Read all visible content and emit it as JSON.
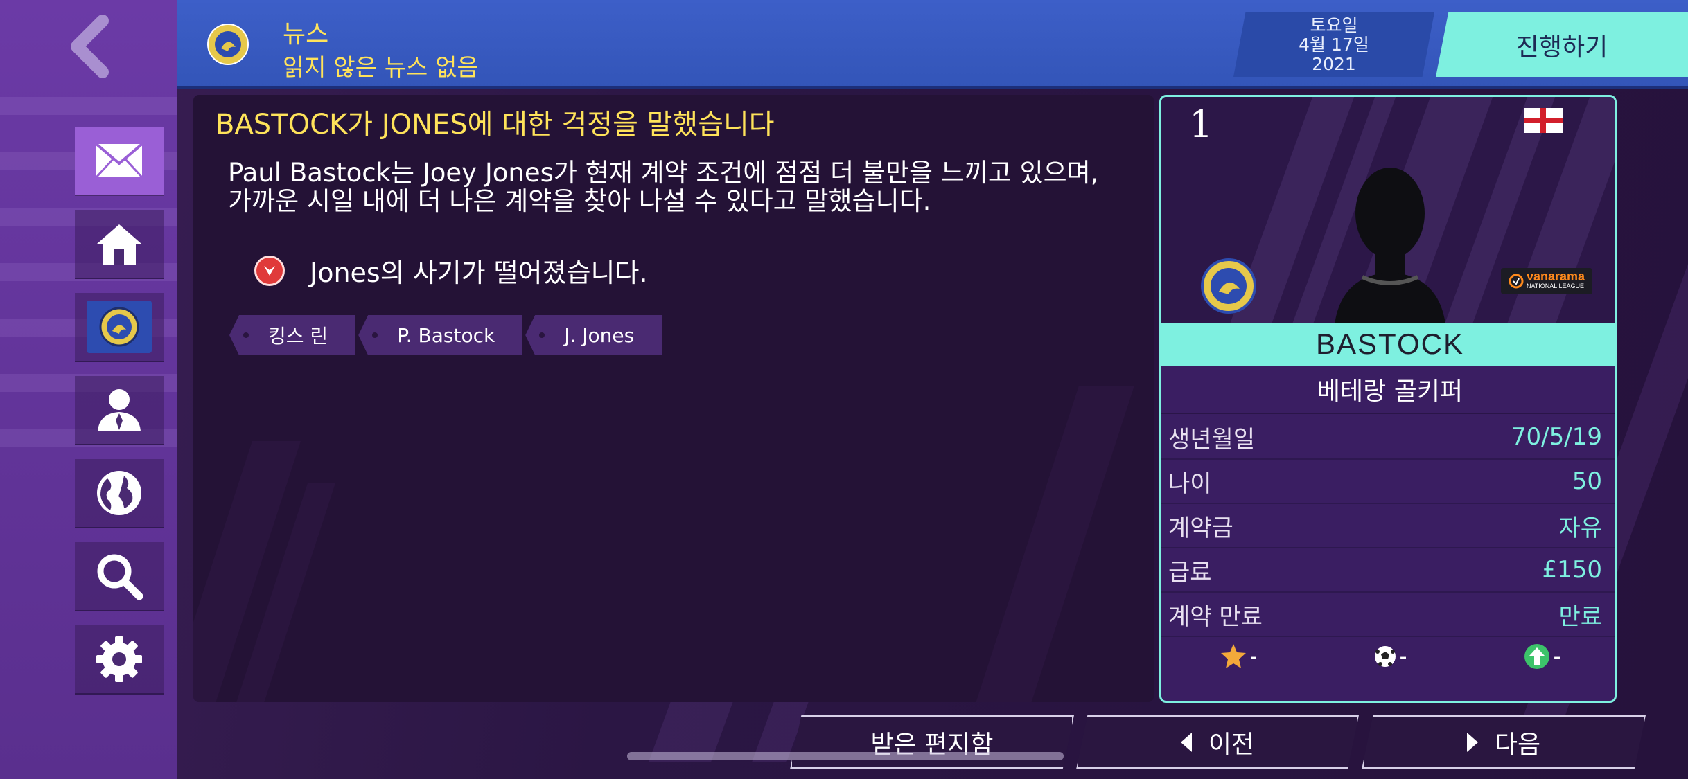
{
  "header": {
    "section_title": "뉴스",
    "subtitle": "읽지 않은 뉴스 없음",
    "date": {
      "weekday": "토요일",
      "date": "4월 17일",
      "year": "2021"
    },
    "continue_label": "진행하기"
  },
  "sidebar": {
    "items": [
      {
        "name": "inbox",
        "icon": "envelope-icon",
        "active": true
      },
      {
        "name": "home",
        "icon": "home-icon",
        "active": false
      },
      {
        "name": "club",
        "icon": "club-crest-icon",
        "active": false
      },
      {
        "name": "manager",
        "icon": "person-icon",
        "active": false
      },
      {
        "name": "world",
        "icon": "globe-icon",
        "active": false
      },
      {
        "name": "search",
        "icon": "magnifier-icon",
        "active": false
      },
      {
        "name": "settings",
        "icon": "gear-icon",
        "active": false
      }
    ]
  },
  "article": {
    "title": "BASTOCK가 JONES에 대한 걱정을 말했습니다",
    "body_line1": "Paul Bastock는 Joey Jones가 현재 계약 조건에 점점 더 불만을 느끼고 있으며,",
    "body_line2": "가까운 시일 내에 더 나은 계약을 찾아 나설 수 있다고 말했습니다.",
    "morale_text": "Jones의 사기가 떨어졌습니다.",
    "tags": [
      "킹스 린",
      "P. Bastock",
      "J. Jones"
    ]
  },
  "player": {
    "squad_number": "1",
    "name": "BASTOCK",
    "position": "베테랑 골키퍼",
    "sponsor_name": "vanarama",
    "sponsor_sub": "NATIONAL LEAGUE",
    "stats": [
      {
        "label": "생년월일",
        "value": "70/5/19"
      },
      {
        "label": "나이",
        "value": "50"
      },
      {
        "label": "계약금",
        "value": "자유"
      },
      {
        "label": "급료",
        "value": "£150"
      },
      {
        "label": "계약 만료",
        "value": "만료"
      }
    ],
    "icon_values": {
      "star": "-",
      "ball": "-",
      "arrow": "-"
    }
  },
  "footer": {
    "inbox_label": "받은 편지함",
    "prev_label": "이전",
    "next_label": "다음"
  },
  "colors": {
    "accent_cyan": "#7ef0e0",
    "headline_yellow": "#ffe35a",
    "header_blue": "#3d5fc8",
    "rail_purple": "#6b3aa6"
  }
}
